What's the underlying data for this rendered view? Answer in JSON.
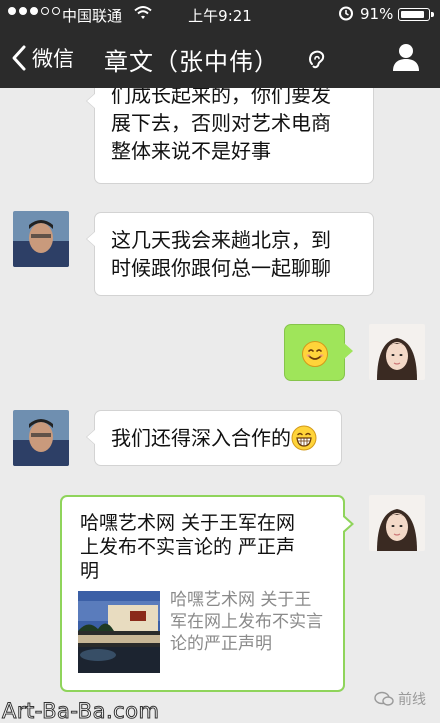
{
  "status_bar": {
    "carrier": "中国联通",
    "time": "上午9:21",
    "battery": "91%",
    "battery_level": 0.91
  },
  "nav": {
    "back_label": "微信",
    "title": "章文（张中伟）"
  },
  "messages": [
    {
      "side": "left",
      "lines": [
        "们成长起来的，你们要发",
        "展下去，否则对艺术电商",
        "整体来说不是好事"
      ]
    },
    {
      "side": "left",
      "lines": [
        "这几天我会来趟北京，到",
        "时候跟你跟何总一起聊聊"
      ]
    },
    {
      "side": "right",
      "emoji": "smile-emoji"
    },
    {
      "side": "left",
      "text": "我们还得深入合作的",
      "emoji": "grin-emoji"
    },
    {
      "side": "right",
      "card": {
        "title_lines": [
          "哈嘿艺术网 关于王军在网",
          "上发布不实言论的 严正声",
          "明"
        ],
        "desc_lines": [
          "哈嘿艺术网 关于王",
          "军在网上发布不实言",
          "论的严正声明"
        ]
      }
    }
  ],
  "watermark": {
    "site": "Art-Ba-Ba.com",
    "logo_text": "前线"
  },
  "colors": {
    "bar_bg": "#2b2b2b",
    "chat_bg": "#ebebeb",
    "green_bubble": "#9fe55a",
    "link_border": "#8fd45b"
  }
}
